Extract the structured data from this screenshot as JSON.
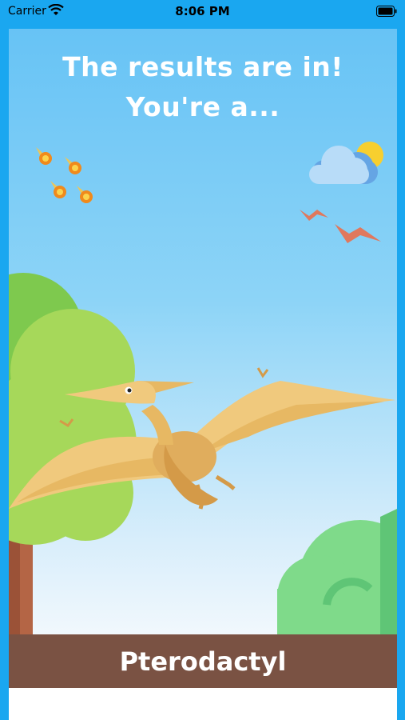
{
  "status_bar": {
    "carrier": "Carrier",
    "time": "8:06 PM"
  },
  "result": {
    "headline_line1": "The results are in!",
    "headline_line2": "You're a...",
    "dinosaur": "Pterodactyl"
  },
  "icons": [
    "wifi-icon",
    "battery-icon",
    "meteor-icon",
    "cloud-sun-icon",
    "pterodactyl-illustration",
    "tree-icon",
    "bush-icon"
  ],
  "colors": {
    "frame": "#1aa7f0",
    "sky_top": "#67c3f5",
    "banner": "#7a5243",
    "text": "#ffffff"
  }
}
